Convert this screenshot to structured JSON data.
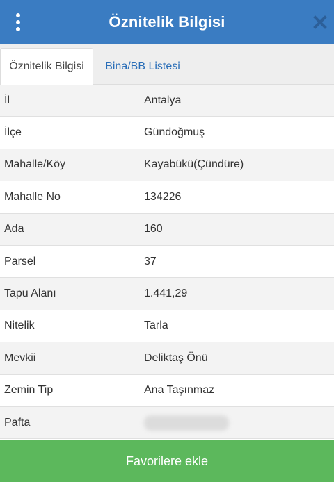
{
  "header": {
    "title": "Öznitelik Bilgisi",
    "menu_icon": "vertical-dots-icon",
    "close_icon": "close-icon",
    "color": "#3a7cc2"
  },
  "tabs": [
    {
      "label": "Öznitelik Bilgisi",
      "active": true
    },
    {
      "label": "Bina/BB Listesi",
      "active": false
    }
  ],
  "attributes": [
    {
      "label": "İl",
      "value": "Antalya"
    },
    {
      "label": "İlçe",
      "value": "Gündoğmuş"
    },
    {
      "label": "Mahalle/Köy",
      "value": "Kayabükü(Çündüre)"
    },
    {
      "label": "Mahalle No",
      "value": "134226"
    },
    {
      "label": "Ada",
      "value": "160"
    },
    {
      "label": "Parsel",
      "value": "37"
    },
    {
      "label": "Tapu Alanı",
      "value": "1.441,29"
    },
    {
      "label": "Nitelik",
      "value": "Tarla"
    },
    {
      "label": "Mevkii",
      "value": "Deliktaş Önü"
    },
    {
      "label": "Zemin Tip",
      "value": "Ana Taşınmaz"
    },
    {
      "label": "Pafta",
      "value": ""
    }
  ],
  "footer": {
    "favorite_label": "Favorilere ekle",
    "color": "#5cb85c"
  }
}
